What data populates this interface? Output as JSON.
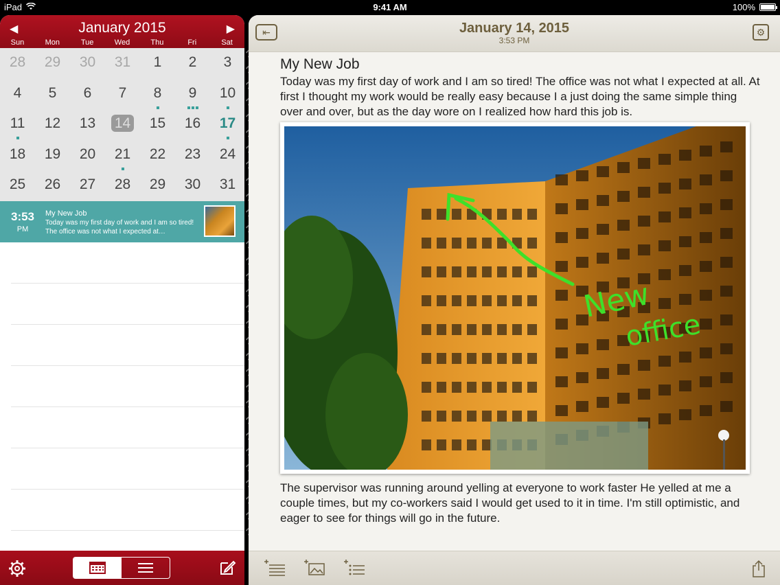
{
  "status_bar": {
    "device": "iPad",
    "time": "9:41 AM",
    "battery": "100%",
    "icons": [
      "wifi-icon",
      "battery-icon"
    ]
  },
  "calendar": {
    "month_title": "January 2015",
    "prev_label": "◀",
    "next_label": "▶",
    "weekdays": [
      "Sun",
      "Mon",
      "Tue",
      "Wed",
      "Thu",
      "Fri",
      "Sat"
    ],
    "weeks": [
      [
        "28",
        "29",
        "30",
        "31",
        "1",
        "2",
        "3"
      ],
      [
        "4",
        "5",
        "6",
        "7",
        "8",
        "9",
        "10"
      ],
      [
        "11",
        "12",
        "13",
        "14",
        "15",
        "16",
        "17"
      ],
      [
        "18",
        "19",
        "20",
        "21",
        "22",
        "23",
        "24"
      ],
      [
        "25",
        "26",
        "27",
        "28",
        "29",
        "30",
        "31"
      ]
    ],
    "selected_day": "14",
    "today": "17"
  },
  "entry_list": [
    {
      "time": "3:53",
      "ampm": "PM",
      "title": "My New Job",
      "preview": "Today was my first day of work and I am so tired!  The office was not what I expected at…"
    }
  ],
  "tabbar": {
    "icons": [
      "gear-icon",
      "calendar-view-icon",
      "list-view-icon",
      "compose-icon"
    ],
    "active_view": "calendar"
  },
  "journal": {
    "date": "January 14, 2015",
    "time": "3:53 PM",
    "title": "My New Job",
    "paragraph1": "Today was my first day of work and I am so tired!  The office was not what I expected at all.  At first I thought my work would be really easy because I a just doing the same simple thing over and over, but as the day wore on I realized how hard this job is.",
    "photo_annotation_line1": "New",
    "photo_annotation_line2": "office",
    "paragraph2": "The supervisor was running around yelling at everyone to work faster  He yelled at me a couple times, but my co-workers said I would get used to it in time.  I'm still optimistic, and eager to see for things will go in the future.",
    "toolbar_icons": [
      "add-text-icon",
      "add-photo-icon",
      "add-list-icon",
      "share-icon"
    ]
  },
  "colors": {
    "header_red": "#9e0d1a",
    "accent_teal": "#4fa7a6",
    "date_brown": "#6d5f3d",
    "annotation_green": "#3ee02a"
  }
}
